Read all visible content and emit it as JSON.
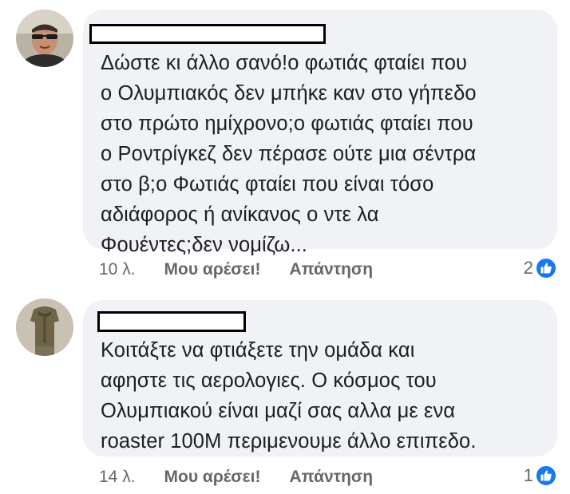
{
  "comments": [
    {
      "lines": [
        "Δώστε κι άλλο σανό!ο φωτιάς φταίει που",
        "ο Ολυμπιακός δεν μπήκε καν στο γήπεδο",
        "στο πρώτο ημίχρονο;ο φωτιάς φταίει που",
        "ο Ροντρίγκεζ δεν πέρασε ούτε μια σέντρα",
        "στο β;ο Φωτιάς φταίει που είναι τόσο",
        "αδιάφορος ή ανίκανος ο ντε λα",
        "Φουέντες;δεν νομίζω..."
      ],
      "time": "10 λ.",
      "like_label": "Μου αρέσει!",
      "reply_label": "Απάντηση",
      "reaction_count": "2",
      "reaction_icon": "like-icon"
    },
    {
      "lines": [
        "Κοιτάξτε να φτιάξετε την ομάδα και",
        "αφηστε τις αερολογιες. Ο κόσμος του",
        "Ολυμπιακού είναι μαζί σας αλλα με ενα",
        "roaster 100M περιμενουμε άλλο επιπεδο."
      ],
      "time": "14 λ.",
      "like_label": "Μου αρέσει!",
      "reply_label": "Απάντηση",
      "reaction_count": "1",
      "reaction_icon": "like-icon"
    }
  ],
  "colors": {
    "bubble": "#f0f2f5",
    "text": "#1c1e21",
    "meta": "#65676b",
    "like_blue": "#1877f2"
  }
}
